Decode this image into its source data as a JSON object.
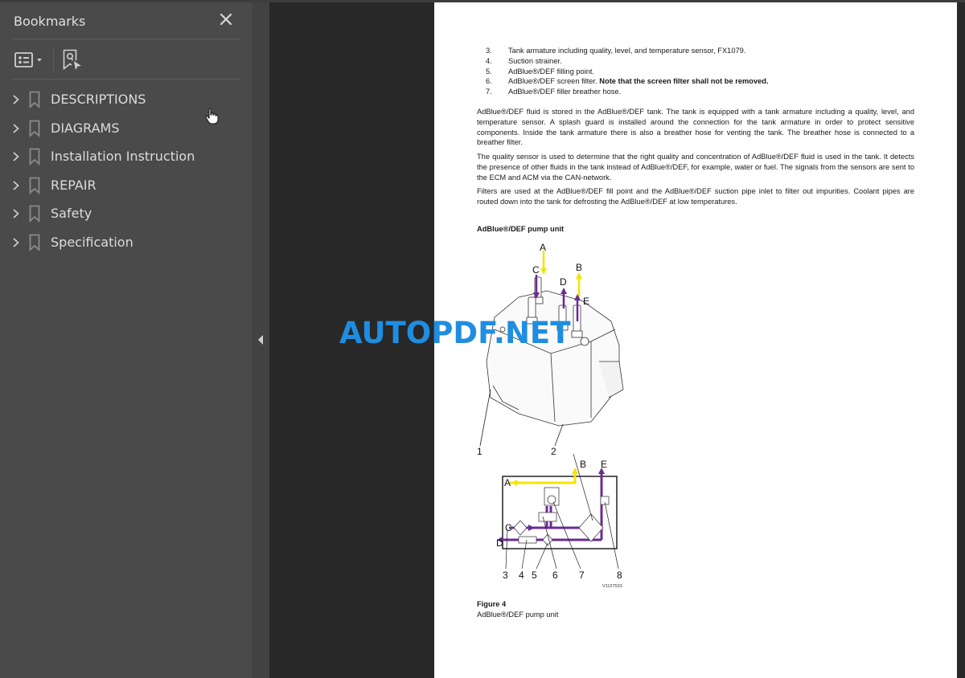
{
  "sidebar": {
    "title": "Bookmarks",
    "close_icon": "close-icon",
    "toolbar": {
      "options_icon": "list-options-icon",
      "find_icon": "find-current-bookmark-icon"
    },
    "items": [
      {
        "label": "DESCRIPTIONS",
        "icon": "bookmark-icon",
        "expand_icon": "chevron-right-icon"
      },
      {
        "label": "DIAGRAMS",
        "icon": "bookmark-icon",
        "expand_icon": "chevron-right-icon"
      },
      {
        "label": "Installation Instruction",
        "icon": "bookmark-icon",
        "expand_icon": "chevron-right-icon"
      },
      {
        "label": "REPAIR",
        "icon": "bookmark-icon",
        "expand_icon": "chevron-right-icon"
      },
      {
        "label": "Safety",
        "icon": "bookmark-icon",
        "expand_icon": "chevron-right-icon"
      },
      {
        "label": "Specification",
        "icon": "bookmark-icon",
        "expand_icon": "chevron-right-icon"
      }
    ]
  },
  "document": {
    "list": [
      {
        "num": "3.",
        "text": "Tank armature including quality, level, and temperature sensor, FX1079.",
        "bold": ""
      },
      {
        "num": "4.",
        "text": "Suction strainer.",
        "bold": ""
      },
      {
        "num": "5.",
        "text": "AdBlue®/DEF filling point.",
        "bold": ""
      },
      {
        "num": "6.",
        "text": "AdBlue®/DEF screen filter. ",
        "bold": "Note that the screen filter shall not be removed."
      },
      {
        "num": "7.",
        "text": "AdBlue®/DEF filler breather hose.",
        "bold": ""
      }
    ],
    "paragraphs": [
      "AdBlue®/DEF fluid is stored in the AdBlue®/DEF tank. The tank is equipped with a tank armature including a quality, level, and temperature sensor. A splash guard is installed around the connection for the tank armature in order to protect sensitive components. Inside the tank armature there is also a breather hose for venting the tank. The breather hose is connected to a breather filter.",
      "The quality sensor is used to determine that the right quality and concentration of AdBlue®/DEF fluid is used in the tank. It detects the presence of other fluids in the tank instead of AdBlue®/DEF, for example, water or fuel. The signals from the sensors are sent to the ECM and ACM via the CAN-network.",
      "Filters are used at the AdBlue®/DEF fill point and the AdBlue®/DEF suction pipe inlet to filter out impurities. Coolant pipes are routed down into the tank for defrosting the AdBlue®/DEF at low temperatures."
    ],
    "section_heading": "AdBlue®/DEF pump unit",
    "figure": {
      "letters": [
        "A",
        "B",
        "C",
        "D",
        "E"
      ],
      "numbers": [
        "1",
        "2",
        "3",
        "4",
        "5",
        "6",
        "7",
        "8"
      ],
      "image_id": "V1127533",
      "title": "Figure 4",
      "caption": "AdBlue®/DEF pump unit",
      "colors": {
        "yellow_flow": "#f5e400",
        "purple_flow": "#6a2c91"
      }
    }
  },
  "watermark": "AUTOPDF.NET"
}
